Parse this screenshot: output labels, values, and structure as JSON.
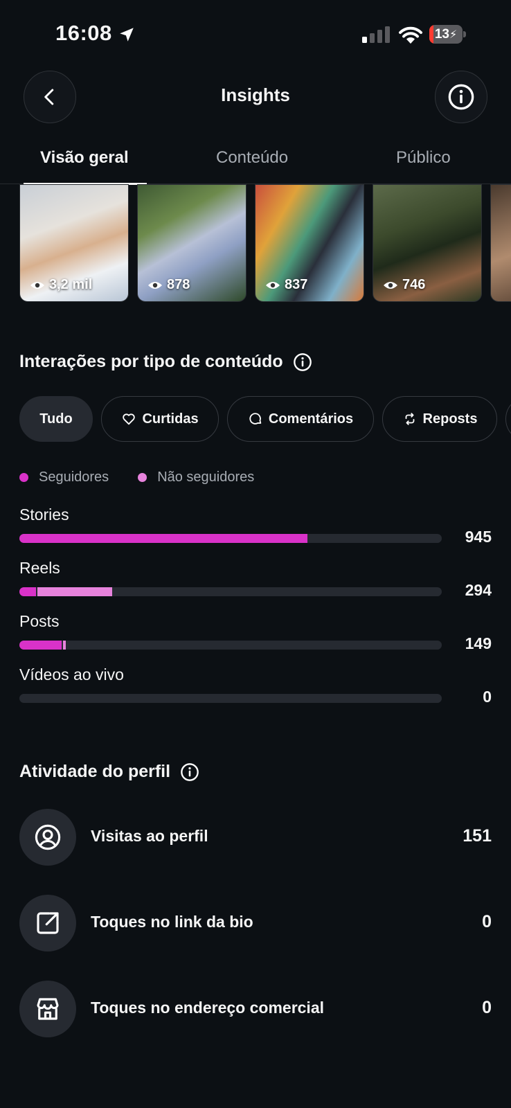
{
  "status_bar": {
    "time": "16:08",
    "battery": "13",
    "battery_level": 0.13
  },
  "header": {
    "title": "Insights"
  },
  "tabs": [
    {
      "label": "Visão geral",
      "active": true
    },
    {
      "label": "Conteúdo",
      "active": false
    },
    {
      "label": "Público",
      "active": false
    }
  ],
  "thumbnails": [
    {
      "views": "3,2 mil"
    },
    {
      "views": "878"
    },
    {
      "views": "837"
    },
    {
      "views": "746"
    },
    {
      "views": ""
    }
  ],
  "interactions": {
    "title": "Interações por tipo de conteúdo",
    "chips": [
      "Tudo",
      "Curtidas",
      "Comentários",
      "Reposts"
    ],
    "legend": {
      "followers": "Seguidores",
      "non_followers": "Não seguidores"
    },
    "colors": {
      "followers": "#d932c8",
      "non_followers": "#e783dc",
      "track": "#262a31"
    },
    "rows": [
      {
        "label": "Stories",
        "value": "945",
        "followers_fraction": 0.682,
        "non_followers_fraction": 0.0
      },
      {
        "label": "Reels",
        "value": "294",
        "followers_fraction": 0.04,
        "non_followers_fraction": 0.176
      },
      {
        "label": "Posts",
        "value": "149",
        "followers_fraction": 0.1,
        "non_followers_fraction": 0.007
      },
      {
        "label": "Vídeos ao vivo",
        "value": "0",
        "followers_fraction": 0.0,
        "non_followers_fraction": 0.0
      }
    ]
  },
  "profile_activity": {
    "title": "Atividade do perfil",
    "rows": [
      {
        "label": "Visitas ao perfil",
        "value": "151",
        "icon": "user-circle-icon"
      },
      {
        "label": "Toques no link da bio",
        "value": "0",
        "icon": "external-link-icon"
      },
      {
        "label": "Toques no endereço comercial",
        "value": "0",
        "icon": "storefront-icon"
      }
    ]
  }
}
